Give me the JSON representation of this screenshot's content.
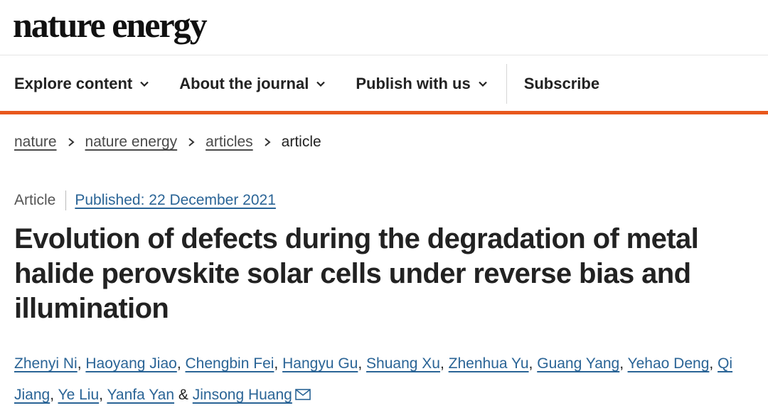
{
  "site": {
    "logo": "nature energy"
  },
  "nav": {
    "items": [
      {
        "label": "Explore content",
        "icon": "chevron-down-icon"
      },
      {
        "label": "About the journal",
        "icon": "chevron-down-icon"
      },
      {
        "label": "Publish with us",
        "icon": "chevron-down-icon"
      }
    ],
    "subscribe": "Subscribe"
  },
  "colors": {
    "accent": "#e8581c",
    "link": "#2a6496",
    "text": "#222222"
  },
  "breadcrumb": {
    "items": [
      "nature",
      "nature energy",
      "articles"
    ],
    "current": "article"
  },
  "article": {
    "type": "Article",
    "published": "Published: 22 December 2021",
    "title": "Evolution of defects during the degradation of metal halide perovskite solar cells under reverse bias and illumination",
    "authors": [
      "Zhenyi Ni",
      "Haoyang Jiao",
      "Chengbin Fei",
      "Hangyu Gu",
      "Shuang Xu",
      "Zhenhua Yu",
      "Guang Yang",
      "Yehao Deng",
      "Qi Jiang",
      "Ye Liu",
      "Yanfa Yan"
    ],
    "last_author": "Jinsong Huang",
    "separator": ",",
    "ampersand": "&"
  }
}
